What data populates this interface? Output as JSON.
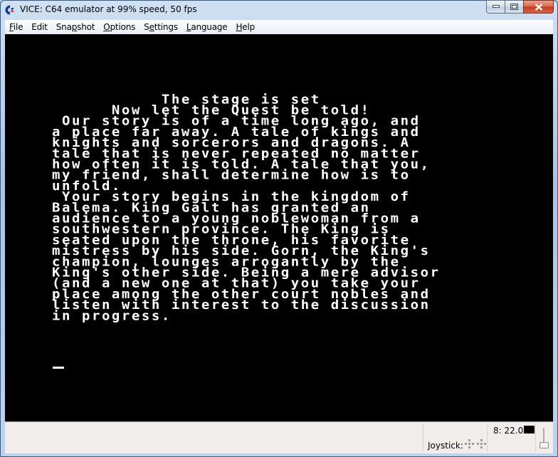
{
  "window": {
    "title": "VICE: C64 emulator at 99% speed, 50 fps",
    "app_icon": "commodore-logo-icon",
    "caption_buttons": {
      "minimize": "minimize-icon",
      "maximize": "maximize-icon",
      "close": "close-icon"
    }
  },
  "menubar": {
    "items": [
      {
        "label": "File",
        "accel": "F",
        "rest": "ile",
        "pre": ""
      },
      {
        "label": "Edit",
        "accel": "",
        "rest": "Edit",
        "pre": ""
      },
      {
        "label": "Snapshot",
        "pre": "Sna",
        "accel": "p",
        "rest": "shot"
      },
      {
        "label": "Options",
        "pre": "",
        "accel": "O",
        "rest": "ptions"
      },
      {
        "label": "Settings",
        "pre": "S",
        "accel": "e",
        "rest": "ttings"
      },
      {
        "label": "Language",
        "pre": "",
        "accel": "L",
        "rest": "anguage"
      },
      {
        "label": "Help",
        "pre": "",
        "accel": "H",
        "rest": "elp"
      }
    ]
  },
  "screen": {
    "background": "#000000",
    "text_color": "#ffffff",
    "lines": [
      "           The stage is set",
      "      Now let the Quest be told!",
      " Our story is of a time long ago, and",
      "a place far away. A tale of kings and",
      "knights and sorcerors and dragons. A",
      "tale that is never repeated no matter",
      "how often it is told. A tale that you,",
      "my friend, shall determine how is to",
      "unfold.",
      " Your story begins in the kingdom of",
      "Balema. King Galt has granted an",
      "audience to a young noblewoman from a",
      "southwestern province. The King is",
      "seated upon the throne, his favorite",
      "mistress by his side. Gorn, the King's",
      "champion, lounges arrogantly by the",
      "King's other side. Being a mere advisor",
      "(and a new one at that) you take your",
      "place among the other court nobles and",
      "listen with interest to the discussion",
      "in progress."
    ],
    "cursor": "_"
  },
  "statusbar": {
    "joystick_label": "Joystick:",
    "drive_status": "8: 22.0",
    "drive_led_color": "#000000"
  }
}
